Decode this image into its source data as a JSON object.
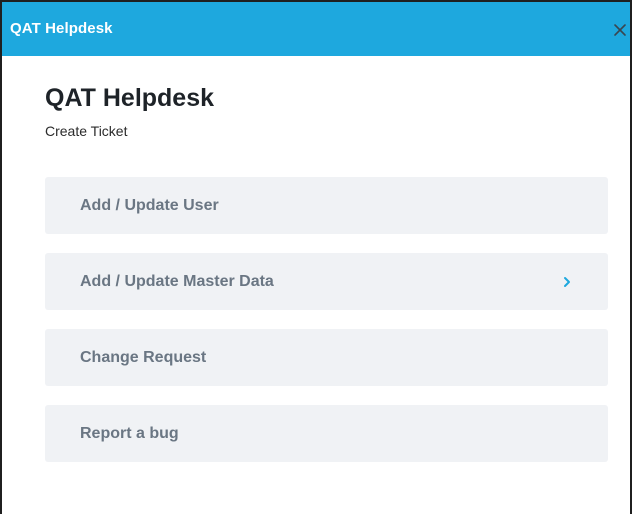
{
  "window": {
    "title": "QAT Helpdesk",
    "close_icon": "close-icon"
  },
  "main": {
    "title": "QAT Helpdesk",
    "subtitle": "Create Ticket"
  },
  "menu": {
    "items": [
      {
        "label": "Add / Update User",
        "has_chevron": false
      },
      {
        "label": "Add / Update Master Data",
        "has_chevron": true,
        "chevron_icon": "chevron-right-icon"
      },
      {
        "label": "Change Request",
        "has_chevron": false
      },
      {
        "label": "Report a bug",
        "has_chevron": false
      }
    ]
  },
  "colors": {
    "titlebar": "#1ea8de",
    "item_background": "#f0f2f5",
    "item_text": "#6a7683",
    "chevron": "#1ea8de"
  }
}
